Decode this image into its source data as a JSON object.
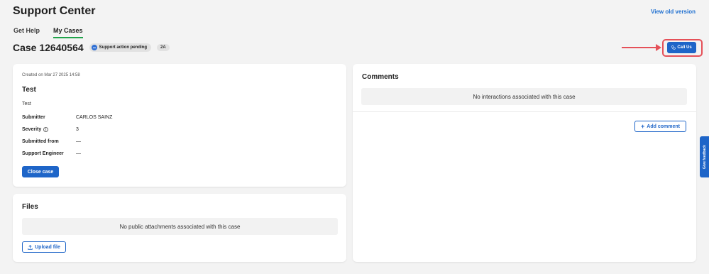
{
  "header": {
    "title": "Support Center",
    "view_old_version": "View old version"
  },
  "tabs": [
    {
      "label": "Get Help",
      "active": false
    },
    {
      "label": "My Cases",
      "active": true
    }
  ],
  "case": {
    "title": "Case 12640564",
    "status": "Support action pending",
    "level": "2A",
    "call_us": "Call Us"
  },
  "details": {
    "created": "Created on Mar 27 2025  14:58",
    "subject": "Test",
    "description": "Test",
    "fields": [
      {
        "label": "Submitter",
        "value": "CARLOS SAINZ"
      },
      {
        "label": "Severity",
        "value": "3"
      },
      {
        "label": "Submitted from",
        "value": "—"
      },
      {
        "label": "Support Engineer",
        "value": "—"
      }
    ],
    "close_case": "Close case"
  },
  "files": {
    "title": "Files",
    "empty_message": "No public attachments associated with this case",
    "upload_label": "Upload file"
  },
  "comments": {
    "title": "Comments",
    "empty_message": "No interactions associated with this case",
    "add_label": "Add comment"
  },
  "feedback": {
    "label": "Give feedback"
  },
  "colors": {
    "accent": "#1e65c8",
    "tab_underline": "#1fa34a",
    "annotation": "#e55058"
  }
}
